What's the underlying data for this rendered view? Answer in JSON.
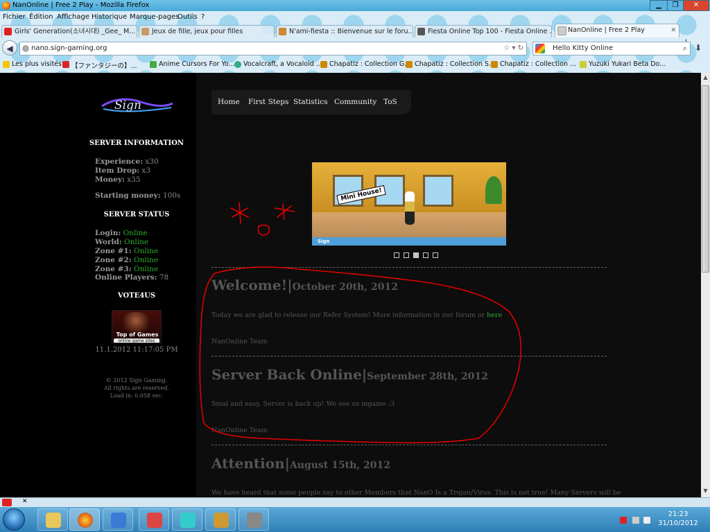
{
  "window": {
    "title": "NanOnline | Free 2 Play - Mozilla Firefox"
  },
  "menu": [
    "Fichier",
    "Édition",
    "Affichage",
    "Historique",
    "Marque-pages",
    "Outils",
    "?"
  ],
  "tabs": [
    {
      "label": "Girls' Generation(소녀시대) _Gee_ M...",
      "color": "#d22"
    },
    {
      "label": "Jeux de fille, jeux pour filles",
      "color": "#c96"
    },
    {
      "label": "N'ami-fiesta :: Bienvenue sur le foru...",
      "color": "#c83"
    },
    {
      "label": "Fiesta Online Top 100 - Fiesta Online ...",
      "color": "#555"
    },
    {
      "label": "NanOnline | Free 2 Play",
      "color": "#999"
    }
  ],
  "url": "nano.sign-gaming.org",
  "search": {
    "value": "Hello Kitty Online"
  },
  "bookmarks": [
    {
      "label": "Les plus visités",
      "color": "#f5c400"
    },
    {
      "label": "【ファンタジーの】...",
      "color": "#d22"
    },
    {
      "label": "Anime Cursors For Yo...",
      "color": "#4a4"
    },
    {
      "label": "Vocalcraft, a Vocaloid ...",
      "color": "#3a8"
    },
    {
      "label": "Chapatiz : Collection G...",
      "color": "#c80"
    },
    {
      "label": "Chapatiz : Collection S...",
      "color": "#c80"
    },
    {
      "label": "Chapatiz : Collection ...",
      "color": "#c80"
    },
    {
      "label": "Yuzuki Yukari Beta Do...",
      "color": "#cc3"
    }
  ],
  "nav": [
    "Home",
    "First Steps",
    "Statistics",
    "Community",
    "ToS"
  ],
  "sidebar": {
    "logo": "Sign",
    "info_heading": "SERVER INFORMATION",
    "rates": [
      {
        "label": "Experience:",
        "value": "x30"
      },
      {
        "label": "Item Drop:",
        "value": "x3"
      },
      {
        "label": "Money:",
        "value": "x35"
      }
    ],
    "starting": {
      "label": "Starting money:",
      "value": "100s"
    },
    "status_heading": "SERVER STATUS",
    "status": [
      {
        "label": "Login:",
        "value": "Online"
      },
      {
        "label": "World:",
        "value": "Online"
      },
      {
        "label": "Zone #1:",
        "value": "Online"
      },
      {
        "label": "Zone #2:",
        "value": "Online"
      },
      {
        "label": "Zone #3:",
        "value": "Online"
      }
    ],
    "players": {
      "label": "Online Players:",
      "value": "78"
    },
    "vote_heading": "VOTE4US",
    "vote_badge": {
      "line1": "Top of Games",
      "line2": "online game sites"
    },
    "datetime": "11.1.2012 11:17:05 PM",
    "footer": [
      "© 2012 Sign Gaming.",
      "All rights are reserved.",
      "Load in: 0.058 sec."
    ]
  },
  "slider": {
    "sign": "Mini House!",
    "watermark": "Sign",
    "active_index": 2,
    "count": 5
  },
  "news": [
    {
      "title": "Welcome!",
      "date": "October 20th, 2012",
      "text": "Today we are glad to release our Refer System! More information in our forum or ",
      "link": "here",
      "author": "NanOnline Team"
    },
    {
      "title": "Server Back Online",
      "date": "September 28th, 2012",
      "text": "Smal and easy, Server is back up! We see us ingame :3",
      "author": "NanOnline Team"
    },
    {
      "title": "Attention",
      "date": "August 15th, 2012",
      "text": "We have heard that some people say to other Members that NanO Is a Trojan/Virus. This is not true! Many Servers will be"
    }
  ],
  "separator": "|",
  "clock": {
    "time": "21:23",
    "date": "31/10/2012"
  },
  "colors": {
    "online": "#2fae2f",
    "annotation": "#e00000"
  }
}
